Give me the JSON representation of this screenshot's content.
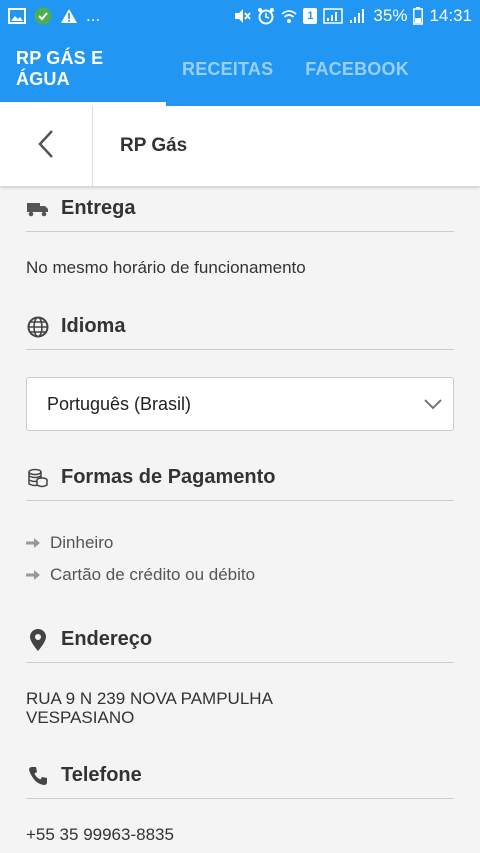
{
  "statusbar": {
    "ellipsis": "...",
    "sim_badge": "1",
    "battery_pct": "35%",
    "time": "14:31"
  },
  "tabs": [
    {
      "label": "RP GÁS E ÁGUA",
      "active": true
    },
    {
      "label": "RECEITAS",
      "active": false
    },
    {
      "label": "FACEBOOK",
      "active": false
    }
  ],
  "header": {
    "title": "RP Gás"
  },
  "sections": {
    "entrega": {
      "title": "Entrega",
      "icon": "truck-icon",
      "text": "No mesmo horário de funcionamento"
    },
    "idioma": {
      "title": "Idioma",
      "icon": "globe-icon",
      "selected": "Português (Brasil)"
    },
    "pagamento": {
      "title": "Formas de Pagamento",
      "icon": "coins-icon",
      "items": [
        "Dinheiro",
        "Cartão de crédito ou débito"
      ]
    },
    "endereco": {
      "title": "Endereço",
      "icon": "map-pin-icon",
      "line1": "RUA 9 N 239 NOVA PAMPULHA",
      "line2": "VESPASIANO"
    },
    "telefone": {
      "title": "Telefone",
      "icon": "phone-icon",
      "number": "+55 35 99963-8835"
    }
  },
  "colors": {
    "primary": "#2196f3",
    "background": "#f4f4f4"
  }
}
